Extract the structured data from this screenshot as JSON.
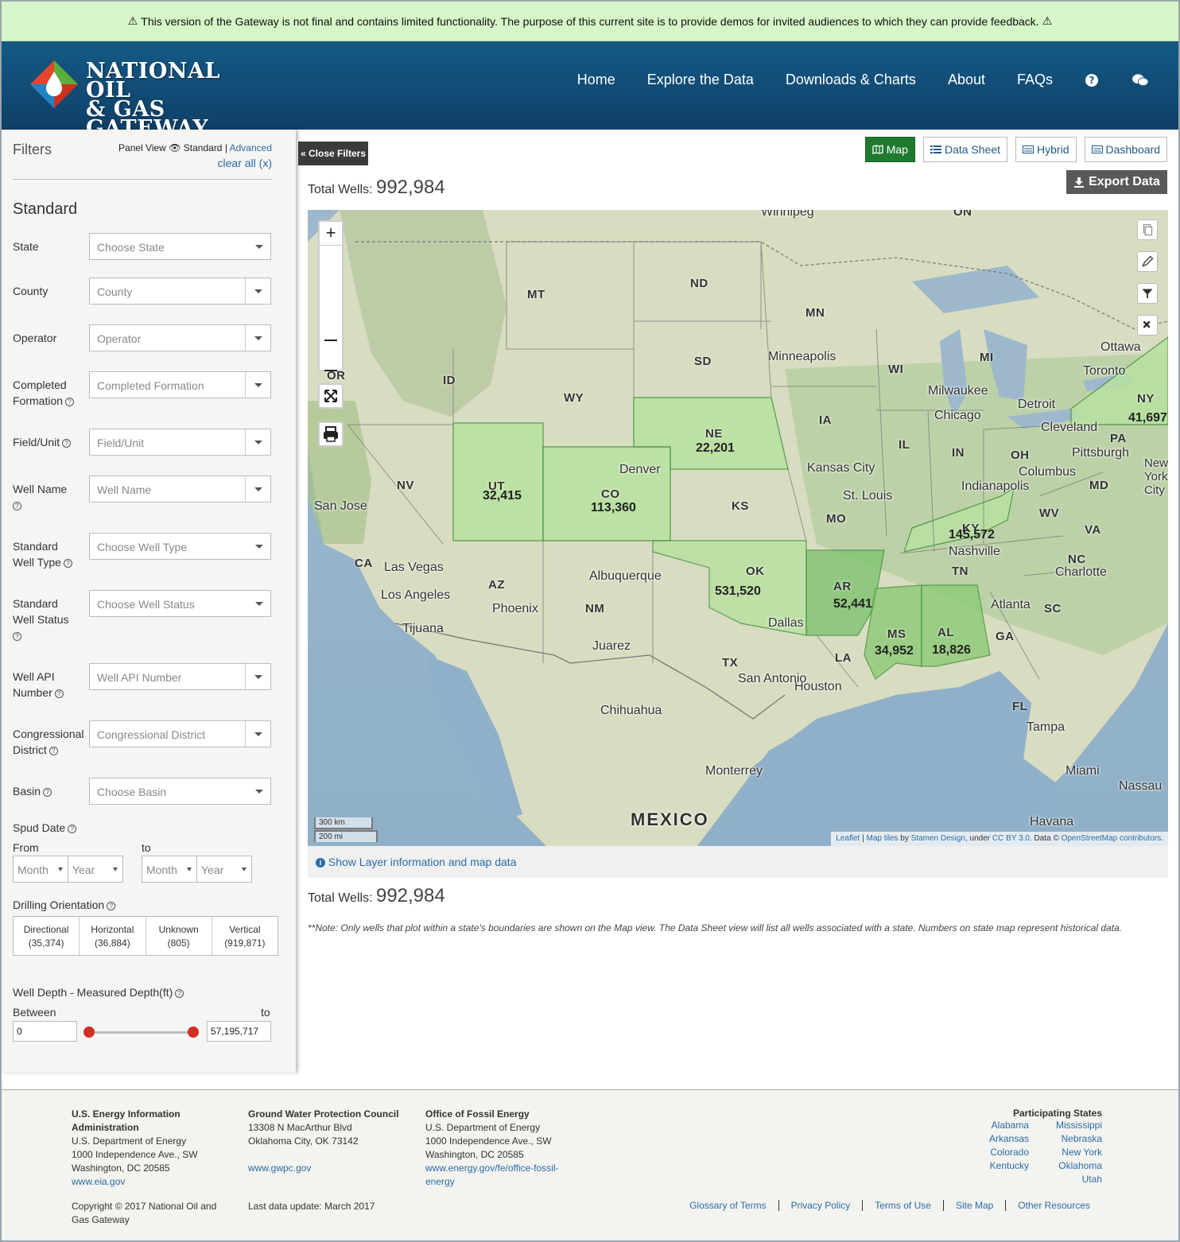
{
  "banner": {
    "text": "This version of the Gateway is not final and contains limited functionality. The purpose of this current site is to provide demos for invited audiences to which they can provide feedback."
  },
  "header": {
    "logo_line1": "NATIONAL OIL",
    "logo_line2": "& GAS GATEWAY",
    "nav": [
      "Home",
      "Explore the Data",
      "Downloads & Charts",
      "About",
      "FAQs"
    ]
  },
  "sidebar": {
    "title": "Filters",
    "panel_view": "Panel View",
    "standard": "Standard",
    "separator": "|",
    "advanced": "Advanced",
    "clear_all": "clear all (x)",
    "section": "Standard",
    "fields": [
      {
        "label": "State",
        "placeholder": "Choose State"
      },
      {
        "label": "County",
        "placeholder": "County"
      },
      {
        "label": "Operator",
        "placeholder": "Operator"
      },
      {
        "label": "Completed Formation",
        "placeholder": "Completed Formation"
      },
      {
        "label": "Field/Unit",
        "placeholder": "Field/Unit"
      },
      {
        "label": "Well Name",
        "placeholder": "Well Name"
      },
      {
        "label": "Standard Well Type",
        "placeholder": "Choose Well Type"
      },
      {
        "label": "Standard Well Status",
        "placeholder": "Choose Well Status"
      },
      {
        "label": "Well API Number",
        "placeholder": "Well API Number"
      },
      {
        "label": "Congressional District",
        "placeholder": "Congressional District"
      },
      {
        "label": "Basin",
        "placeholder": "Choose Basin"
      }
    ],
    "labels": {
      "completed_1": "Completed",
      "completed_2": "Formation",
      "wellname_1": "Well Name",
      "stdtype_1": "Standard",
      "stdtype_2": "Well Type",
      "stdstatus_1": "Standard",
      "stdstatus_2": "Well Status",
      "api_1": "Well API",
      "api_2": "Number",
      "cong_1": "Congressional",
      "cong_2": "District"
    },
    "spud": {
      "label": "Spud Date",
      "from": "From",
      "to": "to",
      "month": "Month",
      "year": "Year"
    },
    "orientation": {
      "label": "Drilling Orientation",
      "items": [
        {
          "name": "Directional",
          "count": "(35,374)"
        },
        {
          "name": "Horizontal",
          "count": "(36,884)"
        },
        {
          "name": "Unknown",
          "count": "(805)"
        },
        {
          "name": "Vertical",
          "count": "(919,871)"
        }
      ]
    },
    "depth": {
      "label": "Well Depth - Measured Depth(ft)",
      "between": "Between",
      "to": "to",
      "min": "0",
      "max": "57,195,717"
    }
  },
  "main": {
    "close_filters": "Close Filters",
    "tabs": [
      "Map",
      "Data Sheet",
      "Hybrid",
      "Dashboard"
    ],
    "export": "Export Data",
    "total_label": "Total Wells:",
    "total_value": "992,984",
    "layer_info": "Show Layer information and map data",
    "note": "**Note: Only wells that plot within a state's boundaries are shown on the Map view. The Data Sheet view will list all wells associated with a state. Numbers on state map represent historical data."
  },
  "map": {
    "states": [
      "MT",
      "ND",
      "MN",
      "SD",
      "WY",
      "ID",
      "NE",
      "IA",
      "WI",
      "MI",
      "IL",
      "IN",
      "OH",
      "PA",
      "NY",
      "NV",
      "UT",
      "CO",
      "KS",
      "MO",
      "KY",
      "WV",
      "VA",
      "CA",
      "AZ",
      "NM",
      "OK",
      "AR",
      "TN",
      "NC",
      "SC",
      "GA",
      "AL",
      "MS",
      "LA",
      "TX",
      "FL",
      "MD",
      "OR"
    ],
    "cities": [
      "Winnipeg",
      "Minneapolis",
      "Milwaukee",
      "Chicago",
      "Detroit",
      "Toronto",
      "Ottawa",
      "Cleveland",
      "Pittsburgh",
      "Columbus",
      "Indianapolis",
      "Kansas City",
      "St. Louis",
      "Denver",
      "San Jose",
      "Las Vegas",
      "Los Angeles",
      "Tijuana",
      "Phoenix",
      "Albuquerque",
      "Juarez",
      "Nashville",
      "Charlotte",
      "Atlanta",
      "Dallas",
      "Houston",
      "San Antonio",
      "Chihuahua",
      "Monterrey",
      "Tampa",
      "Miami",
      "Nassau",
      "Havana",
      "New York City",
      "MEXICO",
      "ON"
    ],
    "counts": {
      "NE": "22,201",
      "UT": "32,415",
      "CO": "113,360",
      "OK": "531,520",
      "AR": "52,441",
      "KY": "145,572",
      "MS": "34,952",
      "AL": "18,826",
      "NY": "41,697"
    },
    "scale_km": "300 km",
    "scale_mi": "200 mi",
    "attribution": {
      "leaflet": "Leaflet",
      "sep": "|",
      "tiles": "Map tiles",
      "by": "by",
      "stamen": "Stamen Design",
      "under": ", under",
      "cc": "CC BY 3.0",
      "data": ". Data ©",
      "osm": "OpenStreetMap contributors",
      "end": "."
    }
  },
  "footer": {
    "eia": {
      "title_1": "U.S. Energy Information",
      "title_2": "Administration",
      "l1": "U.S. Department of Energy",
      "l2": "1000 Independence Ave., SW",
      "l3": "Washington, DC 20585",
      "link": "www.eia.gov"
    },
    "gwpc": {
      "title": "Ground Water Protection Council",
      "l1": "13308 N MacArthur Blvd",
      "l2": "Oklahoma City, OK 73142",
      "link": "www.gwpc.gov"
    },
    "fe": {
      "title": "Office of Fossil Energy",
      "l1": "U.S. Department of Energy",
      "l2": "1000 Independence Ave., SW",
      "l3": "Washington, DC 20585",
      "link_1": "www.energy.gov/fe/office-fossil-",
      "link_2": "energy"
    },
    "copyright_1": "Copyright © 2017 National Oil and",
    "copyright_2": "Gas Gateway",
    "last_update": "Last data update: March 2017",
    "participating_title": "Participating States",
    "states_left": [
      "Alabama",
      "Arkansas",
      "Colorado",
      "Kentucky"
    ],
    "states_right": [
      "Mississippi",
      "Nebraska",
      "New York",
      "Oklahoma",
      "Utah"
    ],
    "links": [
      "Glossary of Terms",
      "Privacy Policy",
      "Terms of Use",
      "Site Map",
      "Other Resources"
    ]
  }
}
